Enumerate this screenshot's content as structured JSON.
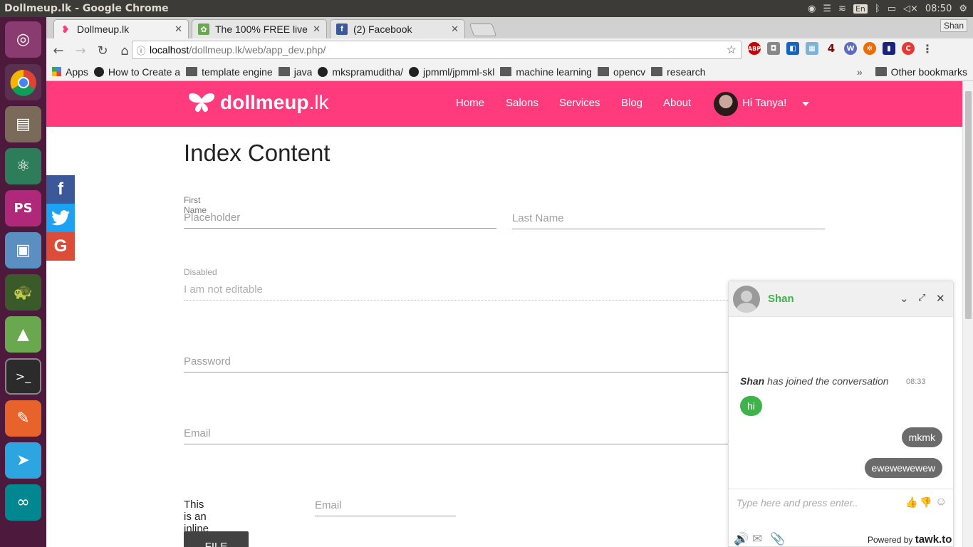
{
  "os": {
    "window_title": "Dollmeup.lk - Google Chrome",
    "keyboard": "En",
    "clock": "08:50",
    "user": "Shan"
  },
  "launcher": {
    "apps": [
      "ubuntu-dash",
      "chrome",
      "files",
      "atom",
      "phpstorm",
      "virtualbox",
      "turtle",
      "android-studio",
      "terminal",
      "postman",
      "telegram",
      "arduino",
      "workspaces"
    ]
  },
  "browser": {
    "tabs": [
      {
        "title": "Dollmeup.lk",
        "active": true
      },
      {
        "title": "The 100% FREE live",
        "active": false
      },
      {
        "title": "(2) Facebook",
        "active": false
      }
    ],
    "url_host": "localhost",
    "url_path": "/dollmeup.lk/web/app_dev.php/",
    "bookmarks": [
      "Apps",
      "How to Create a",
      "template engine",
      "java",
      "mkspramuditha/",
      "jpmml/jpmml-skl",
      "machine learning",
      "opencv",
      "research"
    ],
    "other_bookmarks": "Other bookmarks",
    "profile": "Shan"
  },
  "site": {
    "logo_main": "dollmeup",
    "logo_tld": ".lk",
    "nav": [
      "Home",
      "Salons",
      "Services",
      "Blog",
      "About"
    ],
    "greeting": "Hi Tanya!",
    "social": [
      "f",
      "t",
      "G"
    ],
    "heading": "Index Content",
    "form": {
      "first_name_label": "First Name",
      "first_name_placeholder": "Placeholder",
      "last_name_placeholder": "Last Name",
      "disabled_label": "Disabled",
      "disabled_placeholder": "I am not editable",
      "password_placeholder": "Password",
      "email_placeholder": "Email",
      "inline_label": "This is an inline input field:",
      "inline_placeholder": "Email",
      "file_button": "FILE"
    }
  },
  "chat": {
    "agent": "Shan",
    "joined_name": "Shan",
    "joined_text": " has joined the conversation",
    "joined_time": "08:33",
    "messages": [
      {
        "from": "agent",
        "text": "hi"
      },
      {
        "from": "visitor",
        "text": "mkmk"
      },
      {
        "from": "visitor",
        "text": "ewewewewew"
      }
    ],
    "input_placeholder": "Type here and press enter..",
    "powered_prefix": "Powered by ",
    "powered_brand": "tawk.to"
  },
  "colors": {
    "brand": "#ff3b7e",
    "chat_green": "#3db34a",
    "launcher": "#4d1a3e"
  }
}
